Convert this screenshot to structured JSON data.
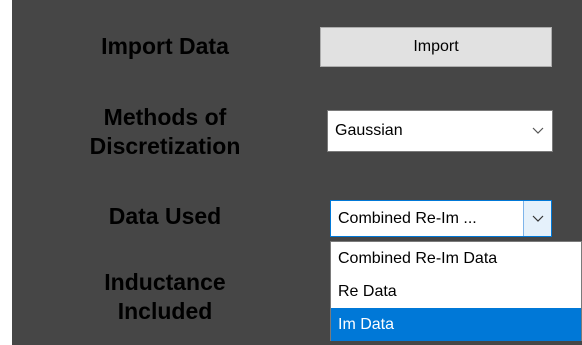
{
  "labels": {
    "import_data": "Import Data",
    "methods": "Methods of\nDiscretization",
    "data_used": "Data Used",
    "inductance": "Inductance\nIncluded"
  },
  "import_button": {
    "label": "Import"
  },
  "discretization_select": {
    "value": "Gaussian",
    "icon": "chevron-down-icon"
  },
  "data_used_select": {
    "value": "Combined Re-Im ...",
    "icon": "chevron-down-icon",
    "expanded": true,
    "options": [
      "Combined Re-Im Data",
      "Re Data",
      "Im Data"
    ],
    "highlighted_option": "Im Data"
  },
  "colors": {
    "panel_background": "#464646",
    "button_face": "#e1e1e1",
    "highlight": "#0078d7"
  }
}
